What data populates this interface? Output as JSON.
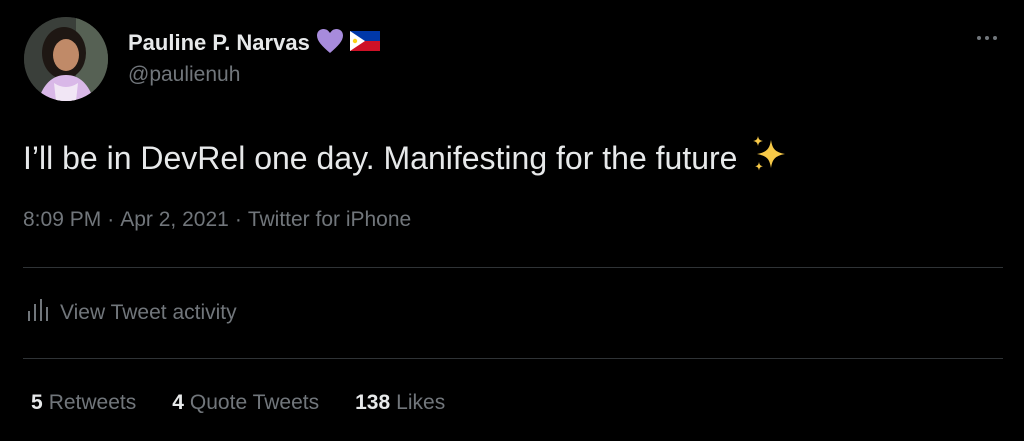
{
  "author": {
    "display_name": "Pauline P. Narvas",
    "handle": "@paulienuh",
    "badges": [
      "purple-heart-icon",
      "philippines-flag-icon"
    ]
  },
  "more_icon": "more-dots-icon",
  "tweet": {
    "text": "I’ll be in DevRel one day. Manifesting for the future",
    "emoji": "sparkles-icon"
  },
  "meta": {
    "time": "8:09 PM",
    "date": "Apr 2, 2021",
    "source": "Twitter for iPhone",
    "separator": "·"
  },
  "activity": {
    "label": "View Tweet activity",
    "icon": "bar-chart-icon"
  },
  "stats": [
    {
      "count": "5",
      "label": "Retweets"
    },
    {
      "count": "4",
      "label": "Quote Tweets"
    },
    {
      "count": "138",
      "label": "Likes"
    }
  ],
  "colors": {
    "background": "#000000",
    "primary_text": "#e7e9ea",
    "secondary_text": "#71767b",
    "divider": "#2f3336",
    "heart": "#a78bdc",
    "sparkle": "#f7c948"
  }
}
